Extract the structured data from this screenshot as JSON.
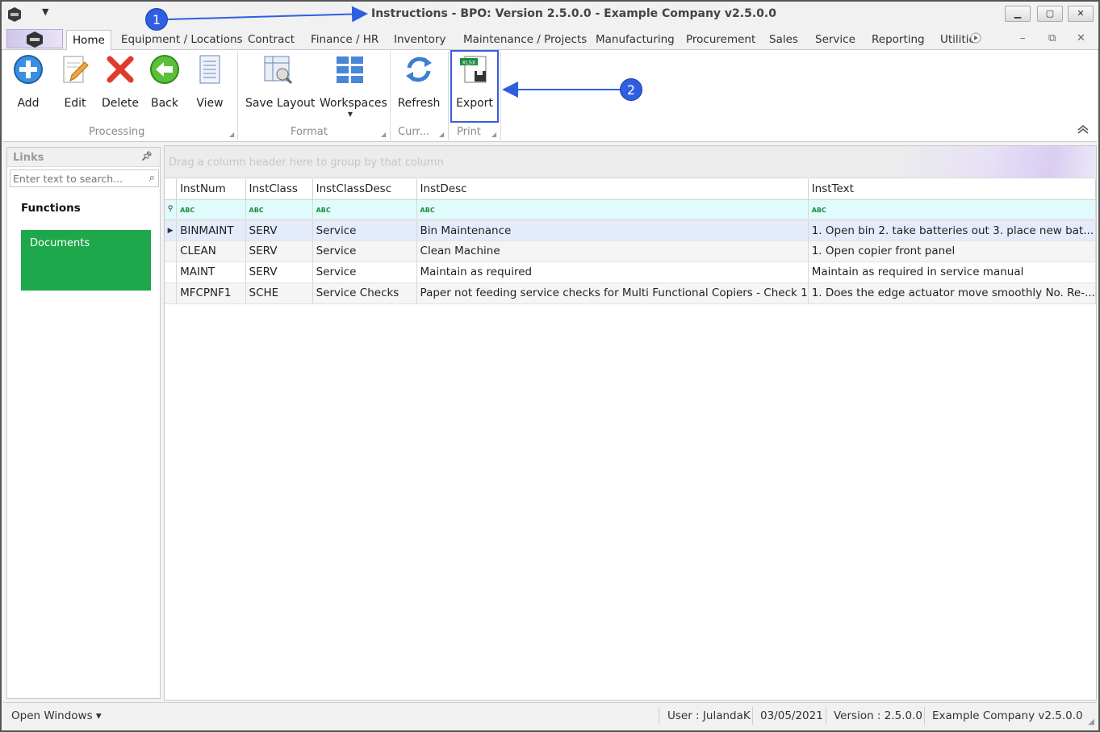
{
  "window": {
    "title": "Instructions - BPO: Version 2.5.0.0 - Example Company v2.5.0.0",
    "controls": {
      "minimize": "▁",
      "maximize": "▢",
      "close": "✕"
    },
    "qa_dropdown": "▼"
  },
  "tabs": [
    {
      "label": "Home",
      "active": true
    },
    {
      "label": "Equipment / Locations"
    },
    {
      "label": "Contract"
    },
    {
      "label": "Finance / HR"
    },
    {
      "label": "Inventory"
    },
    {
      "label": "Maintenance / Projects"
    },
    {
      "label": "Manufacturing"
    },
    {
      "label": "Procurement"
    },
    {
      "label": "Sales"
    },
    {
      "label": "Service"
    },
    {
      "label": "Reporting"
    },
    {
      "label": "Utilitie"
    }
  ],
  "mdi_controls": {
    "minimize": "–",
    "restore": "⧉",
    "close": "✕"
  },
  "ribbon": {
    "processing": {
      "group_label": "Processing",
      "add": "Add",
      "edit": "Edit",
      "delete": "Delete",
      "back": "Back",
      "view": "View"
    },
    "format": {
      "group_label": "Format",
      "save_layout": "Save Layout",
      "workspaces": "Workspaces"
    },
    "current": {
      "group_label": "Curr...",
      "refresh": "Refresh"
    },
    "print": {
      "group_label": "Print",
      "export": "Export",
      "xlsx_badge": "XLSX"
    }
  },
  "annotations": {
    "one": "1",
    "two": "2"
  },
  "links": {
    "header": "Links",
    "search_placeholder": "Enter text to search...",
    "functions_label": "Functions",
    "documents_tile": "Documents"
  },
  "grid": {
    "group_hint": "Drag a column header here to group by that column",
    "columns": [
      "InstNum",
      "InstClass",
      "InstClassDesc",
      "InstDesc",
      "InstText"
    ],
    "filter_icon": "ABC",
    "rows": [
      [
        "BINMAINT",
        "SERV",
        "Service",
        "Bin Maintenance",
        "1. Open bin 2. take batteries out 3. place new bat..."
      ],
      [
        "CLEAN",
        "SERV",
        "Service",
        "Clean Machine",
        "1. Open copier front panel"
      ],
      [
        "MAINT",
        "SERV",
        "Service",
        "Maintain as required",
        "Maintain as required in service manual"
      ],
      [
        "MFCPNF1",
        "SCHE",
        "Service Checks",
        "Paper not feeding service checks for Multi Functional Copiers - Check 1",
        "1. Does the edge actuator move smoothly No. Re-..."
      ]
    ]
  },
  "status": {
    "open_windows": "Open Windows ▾",
    "user": "User : JulandaK",
    "date": "03/05/2021",
    "version": "Version : 2.5.0.0",
    "company": "Example Company v2.5.0.0"
  }
}
